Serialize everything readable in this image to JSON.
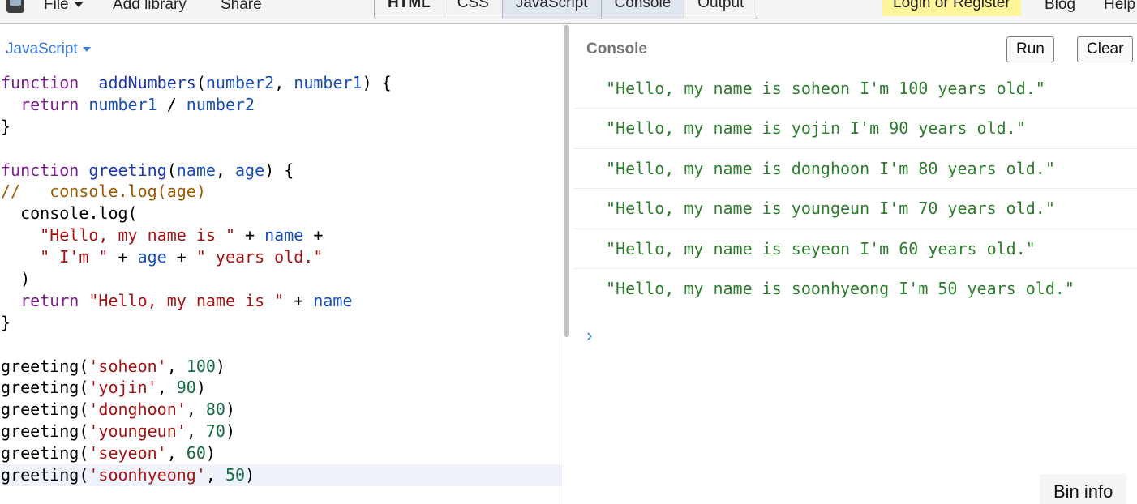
{
  "menu": {
    "file": "File",
    "add_library": "Add library",
    "share": "Share",
    "login": "Login or Register",
    "blog": "Blog",
    "help": "Help"
  },
  "panel_tabs": [
    "HTML",
    "CSS",
    "JavaScript",
    "Console",
    "Output"
  ],
  "editor": {
    "language": "JavaScript",
    "lines": [
      [
        [
          "kw",
          "function"
        ],
        [
          "",
          "  "
        ],
        [
          "def",
          "addNumbers"
        ],
        [
          "",
          "("
        ],
        [
          "var",
          "number2"
        ],
        [
          "",
          ", "
        ],
        [
          "var",
          "number1"
        ],
        [
          "",
          ") {"
        ]
      ],
      [
        [
          "",
          "  "
        ],
        [
          "kw",
          "return"
        ],
        [
          "",
          ""
        ],
        [
          "var",
          " number1"
        ],
        [
          "",
          " / "
        ],
        [
          "var",
          "number2"
        ]
      ],
      [
        [
          "",
          "}"
        ]
      ],
      [
        [
          "",
          ""
        ]
      ],
      [
        [
          "kw",
          "function"
        ],
        [
          "",
          ""
        ],
        [
          "def",
          " greeting"
        ],
        [
          "",
          "("
        ],
        [
          "var",
          "name"
        ],
        [
          "",
          ", "
        ],
        [
          "var",
          "age"
        ],
        [
          "",
          ") {"
        ]
      ],
      [
        [
          "com",
          "//   console.log(age)"
        ]
      ],
      [
        [
          "",
          "  console.log("
        ]
      ],
      [
        [
          "",
          "    "
        ],
        [
          "str",
          "\"Hello, my name is \""
        ],
        [
          "",
          " + "
        ],
        [
          "var",
          "name"
        ],
        [
          "",
          " +"
        ]
      ],
      [
        [
          "",
          "    "
        ],
        [
          "str",
          "\" I'm \""
        ],
        [
          "",
          " + "
        ],
        [
          "var",
          "age"
        ],
        [
          "",
          " + "
        ],
        [
          "str",
          "\" years old.\""
        ]
      ],
      [
        [
          "",
          "  )"
        ]
      ],
      [
        [
          "",
          "  "
        ],
        [
          "kw",
          "return"
        ],
        [
          "",
          ""
        ],
        [
          "str",
          " \"Hello, my name is \""
        ],
        [
          "",
          " + "
        ],
        [
          "var",
          "name"
        ]
      ],
      [
        [
          "",
          "}"
        ]
      ],
      [
        [
          "",
          ""
        ]
      ],
      [
        [
          "",
          "greeting("
        ],
        [
          "str",
          "'soheon'"
        ],
        [
          "",
          ", "
        ],
        [
          "num",
          "100"
        ],
        [
          "",
          ")"
        ]
      ],
      [
        [
          "",
          "greeting("
        ],
        [
          "str",
          "'yojin'"
        ],
        [
          "",
          ", "
        ],
        [
          "num",
          "90"
        ],
        [
          "",
          ")"
        ]
      ],
      [
        [
          "",
          "greeting("
        ],
        [
          "str",
          "'donghoon'"
        ],
        [
          "",
          ", "
        ],
        [
          "num",
          "80"
        ],
        [
          "",
          ")"
        ]
      ],
      [
        [
          "",
          "greeting("
        ],
        [
          "str",
          "'youngeun'"
        ],
        [
          "",
          ", "
        ],
        [
          "num",
          "70"
        ],
        [
          "",
          ")"
        ]
      ],
      [
        [
          "",
          "greeting("
        ],
        [
          "str",
          "'seyeon'"
        ],
        [
          "",
          ", "
        ],
        [
          "num",
          "60"
        ],
        [
          "",
          ")"
        ]
      ],
      [
        [
          "",
          "greeting("
        ],
        [
          "str",
          "'soonhyeong'"
        ],
        [
          "",
          ", "
        ],
        [
          "num",
          "50"
        ],
        [
          "",
          ")"
        ]
      ]
    ]
  },
  "console": {
    "title": "Console",
    "run_label": "Run",
    "clear_label": "Clear",
    "logs": [
      "\"Hello, my name is soheon I'm 100 years old.\"",
      "\"Hello, my name is yojin I'm 90 years old.\"",
      "\"Hello, my name is donghoon I'm 80 years old.\"",
      "\"Hello, my name is youngeun I'm 70 years old.\"",
      "\"Hello, my name is seyeon I'm 60 years old.\"",
      "\"Hello, my name is soonhyeong I'm 50 years old.\""
    ],
    "prompt": "›"
  },
  "bin_info": "Bin info"
}
